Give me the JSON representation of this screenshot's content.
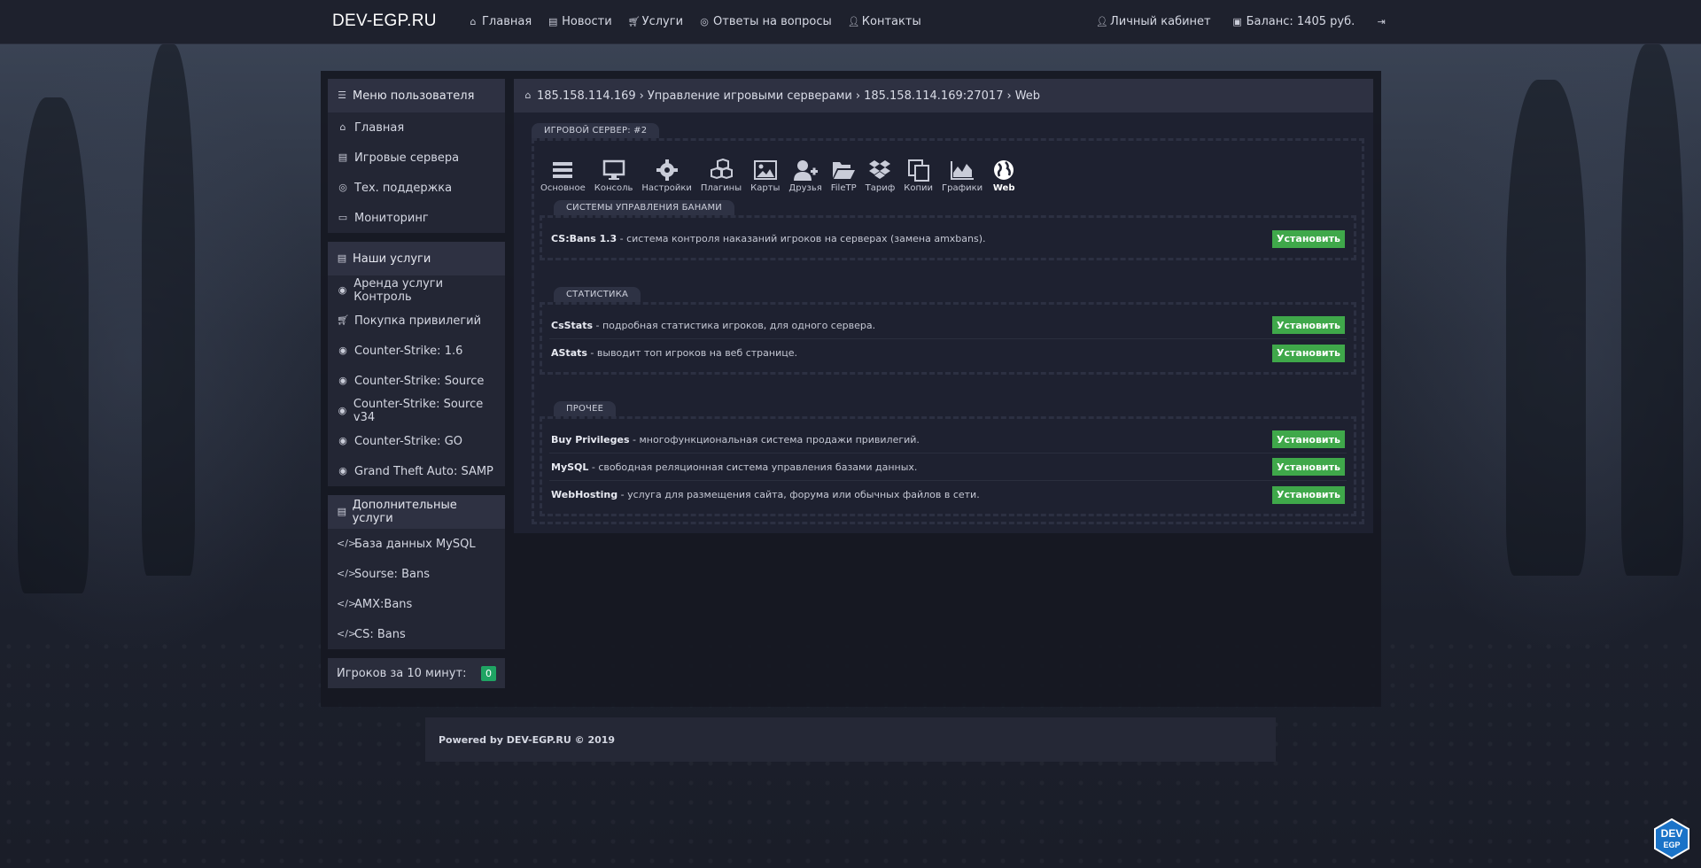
{
  "topbar": {
    "brand": "DEV-EGP.RU",
    "nav": [
      {
        "label": "Главная",
        "icon": "home-icon"
      },
      {
        "label": "Новости",
        "icon": "newspaper-icon"
      },
      {
        "label": "Услуги",
        "icon": "cart-icon"
      },
      {
        "label": "Ответы на вопросы",
        "icon": "lifebuoy-icon"
      },
      {
        "label": "Контакты",
        "icon": "user-icon"
      }
    ],
    "account_label": "Личный кабинет",
    "balance_label": "Баланс: 1405 руб.",
    "logout_icon": "sign-out-icon"
  },
  "sidebar": {
    "user_menu": {
      "title": "Меню пользователя",
      "items": [
        {
          "label": "Главная",
          "icon": "home-icon"
        },
        {
          "label": "Игровые сервера",
          "icon": "server-icon"
        },
        {
          "label": "Тех. поддержка",
          "icon": "lifebuoy-icon"
        },
        {
          "label": "Мониторинг",
          "icon": "desktop-icon"
        }
      ]
    },
    "services": {
      "title": "Наши услуги",
      "items": [
        {
          "label": "Аренда услуги Контроль",
          "icon": "gamepad-icon"
        },
        {
          "label": "Покупка привилегий",
          "icon": "cart-icon"
        },
        {
          "label": "Counter-Strike: 1.6",
          "icon": "gamepad-icon"
        },
        {
          "label": "Counter-Strike: Source",
          "icon": "gamepad-icon"
        },
        {
          "label": "Counter-Strike: Source v34",
          "icon": "gamepad-icon"
        },
        {
          "label": "Counter-Strike: GO",
          "icon": "gamepad-icon"
        },
        {
          "label": "Grand Theft Auto: SAMP",
          "icon": "gamepad-icon"
        }
      ]
    },
    "extra": {
      "title": "Дополнительные услуги",
      "items": [
        {
          "label": "База данных MySQL",
          "icon": "code-icon"
        },
        {
          "label": "Sourse: Bans",
          "icon": "code-icon"
        },
        {
          "label": "AMX:Bans",
          "icon": "code-icon"
        },
        {
          "label": "CS: Bans",
          "icon": "code-icon"
        }
      ]
    },
    "players": {
      "label": "Игроков за 10 минут:",
      "count": "0"
    }
  },
  "breadcrumb": [
    "185.158.114.169",
    "Управление игровыми серверами",
    "185.158.114.169:27017",
    "Web"
  ],
  "server_tag": "ИГРОВОЙ СЕРВЕР: #2",
  "toolbar": [
    {
      "label": "Основное",
      "icon": "bars-icon"
    },
    {
      "label": "Консоль",
      "icon": "monitor-icon"
    },
    {
      "label": "Настройки",
      "icon": "gear-icon"
    },
    {
      "label": "Плагины",
      "icon": "cubes-icon"
    },
    {
      "label": "Карты",
      "icon": "image-icon"
    },
    {
      "label": "Друзья",
      "icon": "user-plus-icon"
    },
    {
      "label": "FileTP",
      "icon": "folder-open-icon"
    },
    {
      "label": "Тариф",
      "icon": "dropbox-icon"
    },
    {
      "label": "Копии",
      "icon": "copy-icon"
    },
    {
      "label": "Графики",
      "icon": "area-chart-icon"
    },
    {
      "label": "Web",
      "icon": "globe-icon",
      "active": true
    }
  ],
  "sections": [
    {
      "title": "СИСТЕМЫ УПРАВЛЕНИЯ БАНАМИ",
      "rows": [
        {
          "name": "CS:Bans 1.3",
          "desc": " - система контроля наказаний игроков на серверах (замена amxbans)."
        }
      ]
    },
    {
      "title": "СТАТИСТИКА",
      "rows": [
        {
          "name": "CsStats",
          "desc": " - подробная статистика игроков, для одного сервера."
        },
        {
          "name": "AStats",
          "desc": " - выводит топ игроков на веб странице."
        }
      ]
    },
    {
      "title": "ПРОЧЕЕ",
      "rows": [
        {
          "name": "Buy Privileges",
          "desc": " - многофункциональная система продажи привилегий."
        },
        {
          "name": "MySQL",
          "desc": " - свободная реляционная система управления базами данных."
        },
        {
          "name": "WebHosting",
          "desc": " - услуга для размещения сайта, форума или обычных файлов в сети."
        }
      ]
    }
  ],
  "install_label": "Установить",
  "footer": "Powered by DEV-EGP.RU © 2019",
  "corner_logo": {
    "line1": "DEV",
    "line2": "EGP"
  },
  "colors": {
    "accent_green": "#3fa84a",
    "badge_green": "#1fa463",
    "logo_blue": "#1a73c8"
  }
}
